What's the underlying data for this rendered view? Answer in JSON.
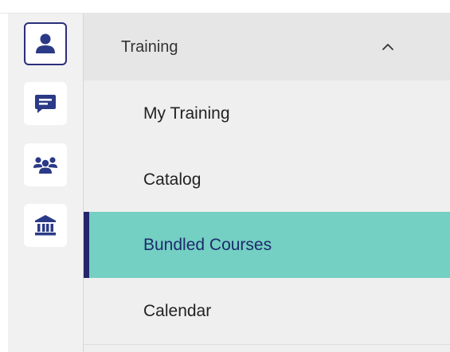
{
  "rail": {
    "items": [
      {
        "icon": "person-icon",
        "active": true
      },
      {
        "icon": "chat-icon",
        "active": false
      },
      {
        "icon": "group-icon",
        "active": false
      },
      {
        "icon": "institution-icon",
        "active": false
      }
    ]
  },
  "menu": {
    "section_title": "Training",
    "expanded": true,
    "items": [
      {
        "label": "My Training",
        "active": false
      },
      {
        "label": "Catalog",
        "active": false
      },
      {
        "label": "Bundled Courses",
        "active": true
      },
      {
        "label": "Calendar",
        "active": false
      }
    ]
  },
  "colors": {
    "accent_dark": "#24266b",
    "active_bg": "#73d0c3",
    "icon": "#2b3a86"
  }
}
